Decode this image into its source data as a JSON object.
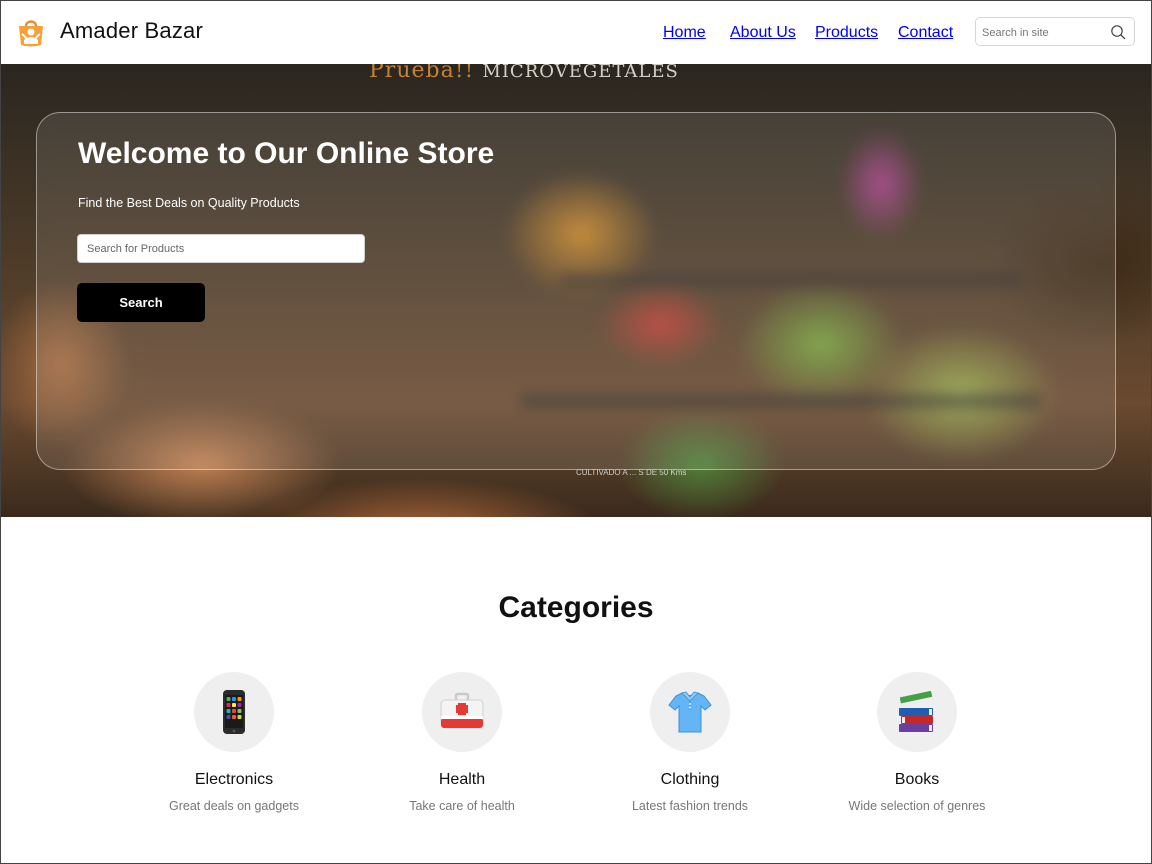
{
  "header": {
    "brand": "Amader Bazar",
    "nav": [
      "Home",
      "About Us",
      "Products",
      "Contact"
    ],
    "search_placeholder": "Search in site"
  },
  "hero": {
    "title": "Welcome to Our Online Store",
    "subtitle": "Find the Best Deals on Quality Products",
    "search_placeholder": "Search for Products",
    "search_button": "Search",
    "background_sign_accent": "Prueba!!",
    "background_sign_text": "MICROVEGETALES",
    "background_price_text": "CULTIVADO A ... S DE 50 Kms"
  },
  "categories": {
    "title": "Categories",
    "items": [
      {
        "name": "Electronics",
        "desc": "Great deals on gadgets",
        "icon": "mobile-phone-icon"
      },
      {
        "name": "Health",
        "desc": "Take care of health",
        "icon": "first-aid-kit-icon"
      },
      {
        "name": "Clothing",
        "desc": "Latest fashion trends",
        "icon": "polo-shirt-icon"
      },
      {
        "name": "Books",
        "desc": "Wide selection of genres",
        "icon": "books-icon"
      }
    ]
  },
  "colors": {
    "logo_orange": "#F5A03A",
    "button_black": "#000000",
    "circle_gray": "#EFEFEF",
    "muted_text": "#777777"
  }
}
